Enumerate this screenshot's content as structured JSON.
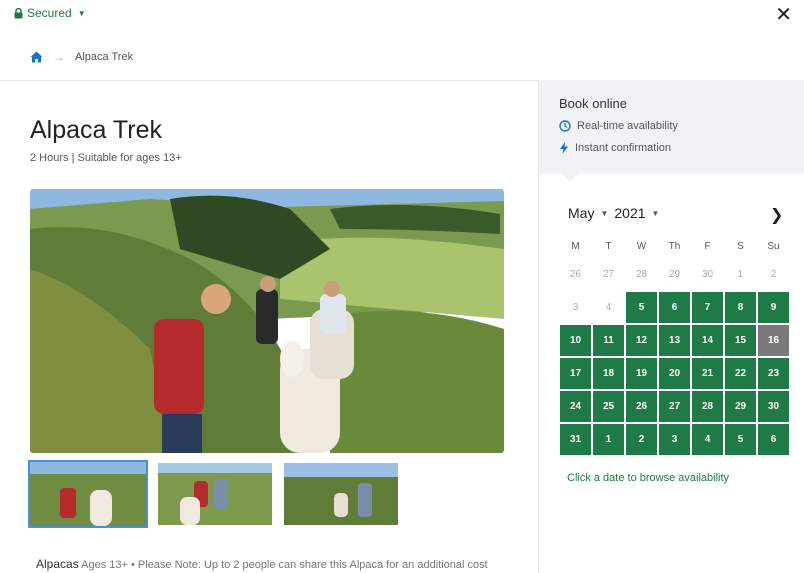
{
  "header": {
    "secured_label": "Secured",
    "close_label": "✕"
  },
  "breadcrumb": {
    "current": "Alpaca Trek"
  },
  "activity": {
    "title": "Alpaca Trek",
    "subtitle": "2 Hours | Suitable for ages 13+"
  },
  "booking": {
    "title": "Book online",
    "features": [
      "Real-time availability",
      "Instant confirmation"
    ]
  },
  "calendar": {
    "month": "May",
    "year": "2021",
    "weekdays": [
      "M",
      "T",
      "W",
      "Th",
      "F",
      "S",
      "Su"
    ],
    "days": [
      {
        "d": "26",
        "s": "out"
      },
      {
        "d": "27",
        "s": "out"
      },
      {
        "d": "28",
        "s": "out"
      },
      {
        "d": "29",
        "s": "out"
      },
      {
        "d": "30",
        "s": "out"
      },
      {
        "d": "1",
        "s": "out"
      },
      {
        "d": "2",
        "s": "out"
      },
      {
        "d": "3",
        "s": "out"
      },
      {
        "d": "4",
        "s": "out"
      },
      {
        "d": "5",
        "s": "avail"
      },
      {
        "d": "6",
        "s": "avail"
      },
      {
        "d": "7",
        "s": "avail"
      },
      {
        "d": "8",
        "s": "avail"
      },
      {
        "d": "9",
        "s": "avail"
      },
      {
        "d": "10",
        "s": "avail"
      },
      {
        "d": "11",
        "s": "avail"
      },
      {
        "d": "12",
        "s": "avail"
      },
      {
        "d": "13",
        "s": "avail"
      },
      {
        "d": "14",
        "s": "avail"
      },
      {
        "d": "15",
        "s": "avail"
      },
      {
        "d": "16",
        "s": "sel"
      },
      {
        "d": "17",
        "s": "avail"
      },
      {
        "d": "18",
        "s": "avail"
      },
      {
        "d": "19",
        "s": "avail"
      },
      {
        "d": "20",
        "s": "avail"
      },
      {
        "d": "21",
        "s": "avail"
      },
      {
        "d": "22",
        "s": "avail"
      },
      {
        "d": "23",
        "s": "avail"
      },
      {
        "d": "24",
        "s": "avail"
      },
      {
        "d": "25",
        "s": "avail"
      },
      {
        "d": "26",
        "s": "avail"
      },
      {
        "d": "27",
        "s": "avail"
      },
      {
        "d": "28",
        "s": "avail"
      },
      {
        "d": "29",
        "s": "avail"
      },
      {
        "d": "30",
        "s": "avail"
      },
      {
        "d": "31",
        "s": "avail"
      },
      {
        "d": "1",
        "s": "avail"
      },
      {
        "d": "2",
        "s": "avail"
      },
      {
        "d": "3",
        "s": "avail"
      },
      {
        "d": "4",
        "s": "avail"
      },
      {
        "d": "5",
        "s": "avail"
      },
      {
        "d": "6",
        "s": "avail"
      }
    ],
    "hint": "Click a date to browse availability"
  },
  "note": {
    "label": "Alpacas",
    "text": "Ages 13+ • Please Note: Up to 2 people can share this Alpaca for an additional cost"
  },
  "colors": {
    "brand_green": "#1e7a46",
    "selected_day": "#7a7a7a",
    "panel_bg": "#f0f2f4"
  },
  "icons": [
    "lock-icon",
    "close-icon",
    "home-icon",
    "arrow-right-icon",
    "clock-icon",
    "lightning-icon",
    "chevron-right-icon"
  ]
}
